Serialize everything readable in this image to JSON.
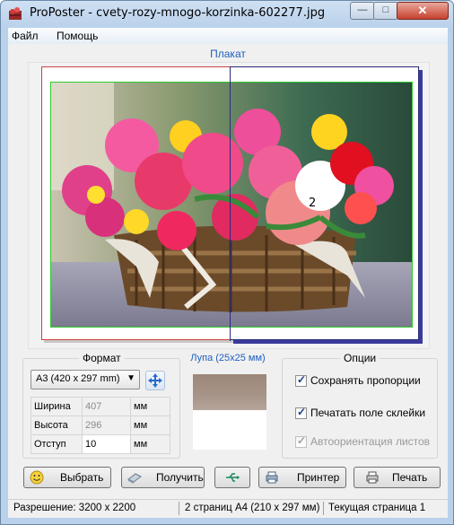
{
  "window": {
    "title": "ProPoster - cvety-rozy-mnogo-korzinka-602277.jpg",
    "close_glyph": "✕",
    "min_glyph": "—",
    "max_glyph": "□"
  },
  "menu": [
    "Файл",
    "Помощь"
  ],
  "poster": {
    "label": "Плакат",
    "page_number": "2",
    "photo_description_icon": "flower-basket-photo"
  },
  "format": {
    "title": "Формат",
    "paper_selected": "A3 (420 x 297 mm)",
    "rows": [
      {
        "label": "Ширина",
        "value": "407",
        "unit": "мм"
      },
      {
        "label": "Высота",
        "value": "296",
        "unit": "мм"
      },
      {
        "label": "Отступ",
        "value": "10",
        "unit": "мм"
      }
    ]
  },
  "loupe": {
    "title": "Лупа (25x25 мм)"
  },
  "options": {
    "title": "Опции",
    "items": [
      {
        "label": "Сохранять пропорции",
        "checked": true,
        "enabled": true
      },
      {
        "label": "Печатать поле склейки",
        "checked": true,
        "enabled": true
      },
      {
        "label": "Автоориентация листов",
        "checked": true,
        "enabled": false
      }
    ]
  },
  "buttons": {
    "select": "Выбрать",
    "get": "Получить",
    "printer": "Принтер",
    "print": "Печать"
  },
  "status": {
    "resolution": "Разрешение: 3200 x 2200",
    "pages": "2 страниц A4 (210 x 297 мм)",
    "current": "Текущая страница 1"
  },
  "colors": {
    "accent_blue": "#1f5fbf",
    "sheet1_border": "#d04040",
    "sheet2_border": "#2a2a7a",
    "photo_border": "#2fcc2f"
  }
}
